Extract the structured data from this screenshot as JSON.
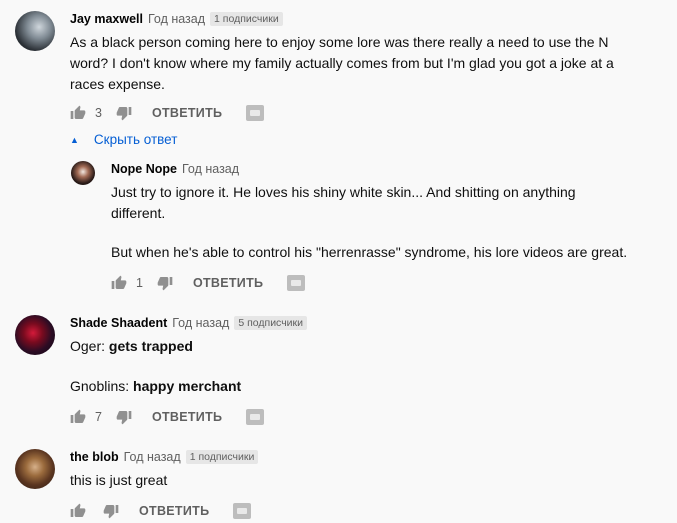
{
  "comments": [
    {
      "author": "Jay maxwell",
      "time": "Год назад",
      "subs": "1 подписчики",
      "text": "As a black person coming here to enjoy some lore was there really a need to use the N word? I don't know where my family actually comes from but I'm glad you got a joke at a races expense.",
      "likes": "3",
      "reply_label": "ОТВЕТИТЬ"
    },
    {
      "author": "Shade Shaadent",
      "time": "Год назад",
      "subs": "5 подписчики",
      "line1_prefix": "Oger: ",
      "line1_bold": "gets trapped",
      "line2_prefix": "Gnoblins: ",
      "line2_bold": "happy merchant",
      "likes": "7",
      "reply_label": "ОТВЕТИТЬ"
    },
    {
      "author": "the blob",
      "time": "Год назад",
      "subs": "1 подписчики",
      "text": "this is just great",
      "likes": "",
      "reply_label": "ОТВЕТИТЬ"
    }
  ],
  "thread": {
    "toggle_label": "Скрыть ответ"
  },
  "reply": {
    "author": "Nope Nope",
    "time": "Год назад",
    "text1": "Just try to ignore it. He loves his shiny white skin... And shitting on anything different.",
    "text2": "But when he's able to control his \"herrenrasse\" syndrome, his lore videos are great.",
    "likes": "1",
    "reply_label": "ОТВЕТИТЬ"
  },
  "colors": {
    "link": "#065fd4",
    "icon": "#909090",
    "meta": "#606060"
  },
  "icons": [
    "thumb-up-icon",
    "thumb-down-icon",
    "creator-heart-icon"
  ]
}
